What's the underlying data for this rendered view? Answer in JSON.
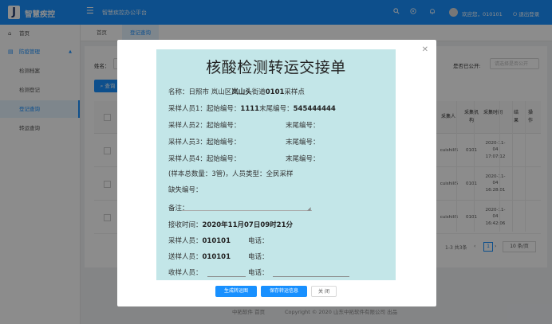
{
  "header": {
    "logo_letter": "J",
    "app_title": "智慧疾控",
    "platform": "智慧疾控办公平台",
    "welcome": "欢迎您，010101",
    "logout": "退出登录"
  },
  "sidebar": {
    "items": [
      {
        "label": "首页"
      },
      {
        "label": "防疫管理"
      },
      {
        "label": "检测档案"
      },
      {
        "label": "检测登记"
      },
      {
        "label": "登记查询"
      },
      {
        "label": "转运查询"
      }
    ]
  },
  "tabs": [
    "首页",
    "登记查询"
  ],
  "filters": {
    "name_label": "姓名：",
    "public_label": "是否已公开:",
    "public_placeholder": "请选择是否公开",
    "query_button": "查询"
  },
  "table": {
    "headers": [
      "采集人",
      "采集机构",
      "采集时间",
      "结果",
      "操作"
    ],
    "rows": [
      {
        "collector": "cuishili5",
        "org": "0101",
        "date": "2020-11-04",
        "time": "17:07:12"
      },
      {
        "collector": "cuishili5",
        "org": "0101",
        "date": "2020-11-04",
        "time": "16:28:01"
      },
      {
        "collector": "cuishili5",
        "org": "0101",
        "date": "2020-11-04",
        "time": "16:42:06"
      }
    ],
    "pager_range": "1-3 共3条",
    "page": "1",
    "page_size": "10 条/页"
  },
  "footer": {
    "links": "中拓软件 首页",
    "copyright": "Copyright © 2020 山东中拓软件有限公司 出品"
  },
  "modal": {
    "title": "核酸检测转运交接单",
    "name_prefix": "名称：日照市 岚山区",
    "name_bold1": "岚山头",
    "name_mid": "街道",
    "name_bold2": "0101",
    "name_suffix": "采样点",
    "collector1_label": "采样人员1：起始编号：",
    "collector1_start": "1111",
    "collector1_end_label": "末尾编号：",
    "collector1_end": "545444444",
    "collector2": "采样人员2：起始编号：",
    "collector3": "采样人员3：起始编号：",
    "collector4": "采样人员4：起始编号：",
    "end_label": "末尾编号：",
    "sample_total": "(样本总数量：3管)，人员类型：全民采样",
    "missing": "缺失编号：",
    "remark": "备注：",
    "receive_label": "接收时间：",
    "receive_time": "2020年11月07日09时21分",
    "sampler_label": "采样人员：",
    "sampler": "010101",
    "sender_label": "送样人员：",
    "sender": "010101",
    "receiver_label": "收样人员：",
    "phone_label": "电话：",
    "btn_generate": "生成转运图",
    "btn_save": "保存转运信息",
    "btn_close": "关 闭"
  }
}
